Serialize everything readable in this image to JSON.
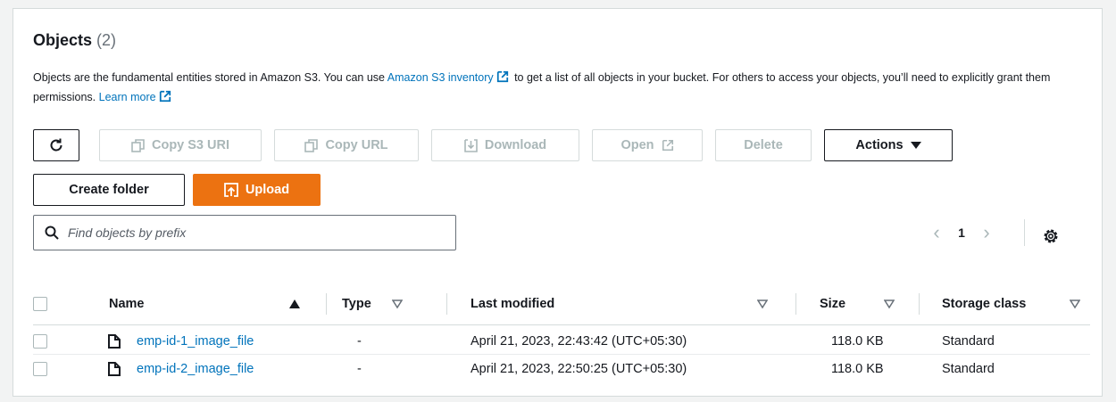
{
  "header": {
    "title": "Objects",
    "count": "(2)",
    "desc_part1": "Objects are the fundamental entities stored in Amazon S3. You can use ",
    "desc_link1": "Amazon S3 inventory",
    "desc_part2": " to get a list of all objects in your bucket. For others to access your objects, you’ll need to explicitly grant them permissions. ",
    "desc_link2": "Learn more"
  },
  "toolbar": {
    "copy_s3_uri": "Copy S3 URI",
    "copy_url": "Copy URL",
    "download": "Download",
    "open": "Open",
    "delete": "Delete",
    "actions": "Actions",
    "create_folder": "Create folder",
    "upload": "Upload"
  },
  "search": {
    "placeholder": "Find objects by prefix",
    "value": ""
  },
  "pagination": {
    "current_page": "1"
  },
  "table": {
    "columns": [
      "Name",
      "Type",
      "Last modified",
      "Size",
      "Storage class"
    ],
    "rows": [
      {
        "name": "emp-id-1_image_file",
        "type": "-",
        "last_modified": "April 21, 2023, 22:43:42 (UTC+05:30)",
        "size": "118.0 KB",
        "storage_class": "Standard"
      },
      {
        "name": "emp-id-2_image_file",
        "type": "-",
        "last_modified": "April 21, 2023, 22:50:25 (UTC+05:30)",
        "size": "118.0 KB",
        "storage_class": "Standard"
      }
    ]
  },
  "colors": {
    "accent": "#ec7211",
    "link": "#0073bb",
    "disabled": "#aab7b8",
    "border": "#d5dbdb"
  },
  "icons": [
    "refresh-icon",
    "copy-icon",
    "download-icon",
    "external-link-icon",
    "caret-down-icon",
    "upload-icon",
    "search-icon",
    "chevron-left-icon",
    "chevron-right-icon",
    "gear-icon",
    "sort-ascending-icon",
    "sort-icon",
    "file-icon"
  ]
}
